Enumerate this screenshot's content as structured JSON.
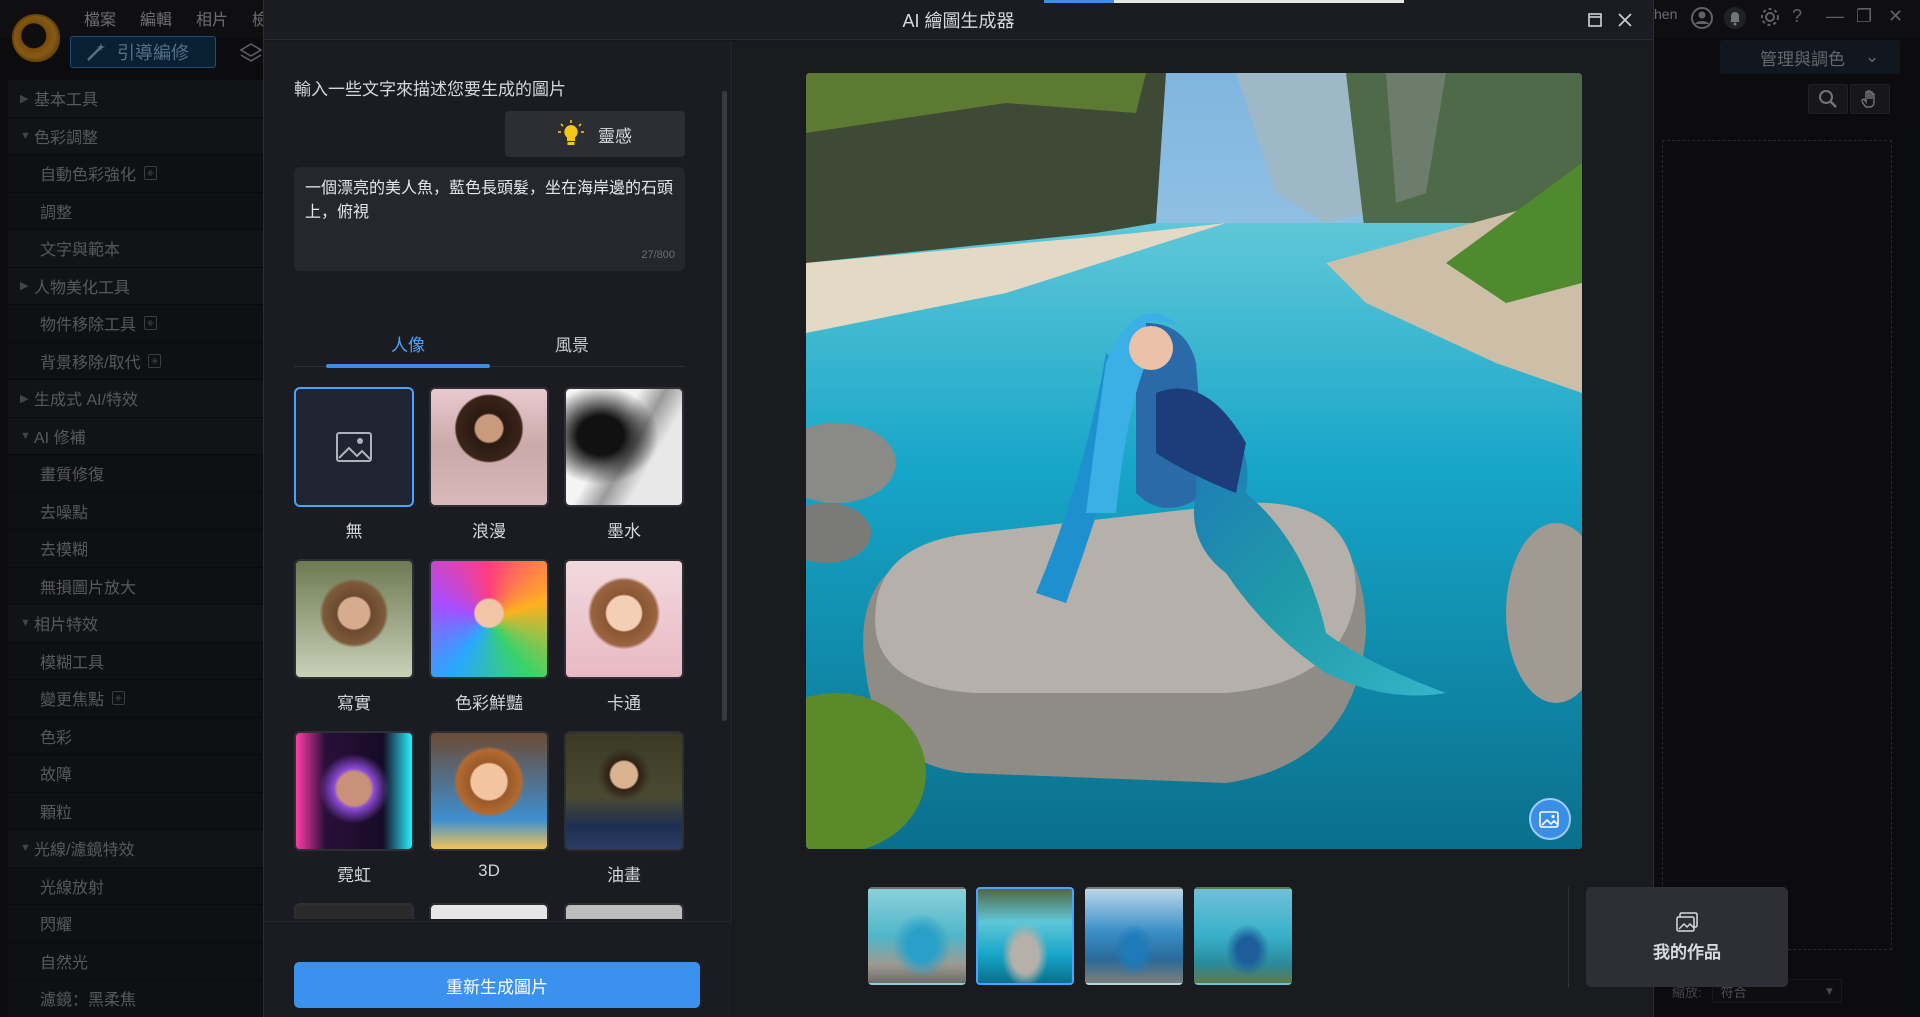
{
  "app": {
    "menu": [
      "檔案",
      "編輯",
      "相片",
      "檢"
    ],
    "guided_tab": "引導編修",
    "user_fragment": "hen",
    "right_dropdown": "管理與調色",
    "zoom_label": "縮放:",
    "zoom_value": "符合",
    "sidebar": [
      {
        "type": "head",
        "label": "基本工具",
        "expanded": false
      },
      {
        "type": "head",
        "label": "色彩調整",
        "expanded": true
      },
      {
        "type": "item",
        "label": "自動色彩強化",
        "ai": true
      },
      {
        "type": "item",
        "label": "調整",
        "ai": false
      },
      {
        "type": "head-plain",
        "label": "文字與範本"
      },
      {
        "type": "head",
        "label": "人物美化工具",
        "expanded": false
      },
      {
        "type": "item",
        "label": "物件移除工具",
        "ai": true
      },
      {
        "type": "item",
        "label": "背景移除/取代",
        "ai": true
      },
      {
        "type": "head",
        "label": "生成式 AI/特效",
        "expanded": false
      },
      {
        "type": "head",
        "label": "AI 修補",
        "expanded": true
      },
      {
        "type": "item",
        "label": "畫質修復",
        "ai": false
      },
      {
        "type": "item",
        "label": "去噪點",
        "ai": false
      },
      {
        "type": "item",
        "label": "去模糊",
        "ai": false
      },
      {
        "type": "item",
        "label": "無損圖片放大",
        "ai": false
      },
      {
        "type": "head",
        "label": "相片特效",
        "expanded": true
      },
      {
        "type": "item",
        "label": "模糊工具",
        "ai": false
      },
      {
        "type": "item",
        "label": "變更焦點",
        "ai": true
      },
      {
        "type": "item",
        "label": "色彩",
        "ai": false
      },
      {
        "type": "item",
        "label": "故障",
        "ai": false
      },
      {
        "type": "item",
        "label": "顆粒",
        "ai": false
      },
      {
        "type": "head",
        "label": "光線/濾鏡特效",
        "expanded": true
      },
      {
        "type": "item",
        "label": "光線放射",
        "ai": false
      },
      {
        "type": "item",
        "label": "閃耀",
        "ai": false
      },
      {
        "type": "item",
        "label": "自然光",
        "ai": false
      },
      {
        "type": "item",
        "label": "濾鏡：黑柔焦",
        "ai": false
      }
    ]
  },
  "dialog": {
    "title": "AI 繪圖生成器",
    "prompt_label": "輸入一些文字來描述您要生成的圖片",
    "inspiration_label": "靈感",
    "prompt_text": "一個漂亮的美人魚，藍色長頭髮，坐在海岸邊的石頭上，俯視",
    "char_count": "27/800",
    "tabs": [
      "人像",
      "風景"
    ],
    "active_tab": 0,
    "styles": [
      {
        "label": "無",
        "selected": true
      },
      {
        "label": "浪漫",
        "selected": false
      },
      {
        "label": "墨水",
        "selected": false
      },
      {
        "label": "寫實",
        "selected": false
      },
      {
        "label": "色彩鮮豔",
        "selected": false
      },
      {
        "label": "卡通",
        "selected": false
      },
      {
        "label": "霓虹",
        "selected": false
      },
      {
        "label": "3D",
        "selected": false
      },
      {
        "label": "油畫",
        "selected": false
      }
    ],
    "regenerate_label": "重新生成圖片",
    "results_selected": 1,
    "my_works_label": "我的作品"
  }
}
